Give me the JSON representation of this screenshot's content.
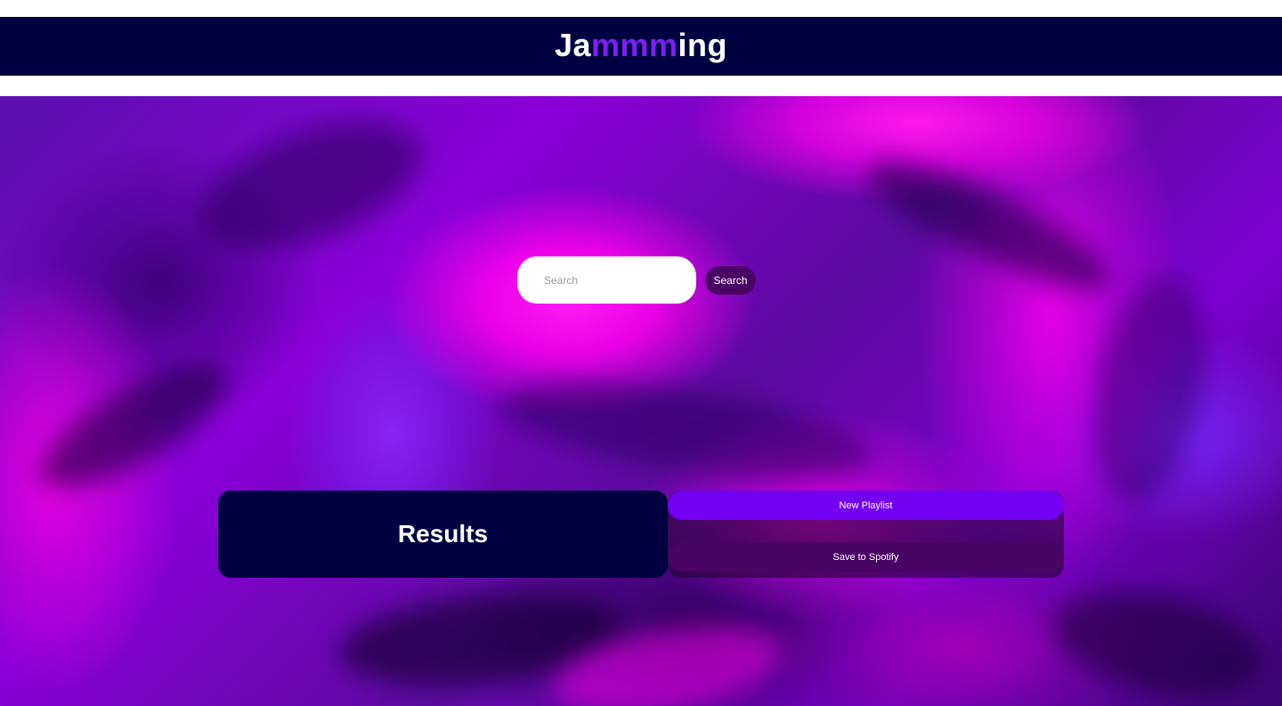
{
  "header": {
    "brand_prefix": "Ja",
    "brand_accent": "mmm",
    "brand_suffix": "ing",
    "background_color": "#010040",
    "accent_color": "#7a1ff5"
  },
  "search": {
    "placeholder": "Search",
    "value": "",
    "button_label": "Search"
  },
  "results": {
    "title": "Results"
  },
  "playlist": {
    "name_placeholder": "New Playlist",
    "name_value": "",
    "save_label": "Save to Spotify",
    "name_field_color": "#7300f0",
    "save_button_color": "#4a0464"
  }
}
